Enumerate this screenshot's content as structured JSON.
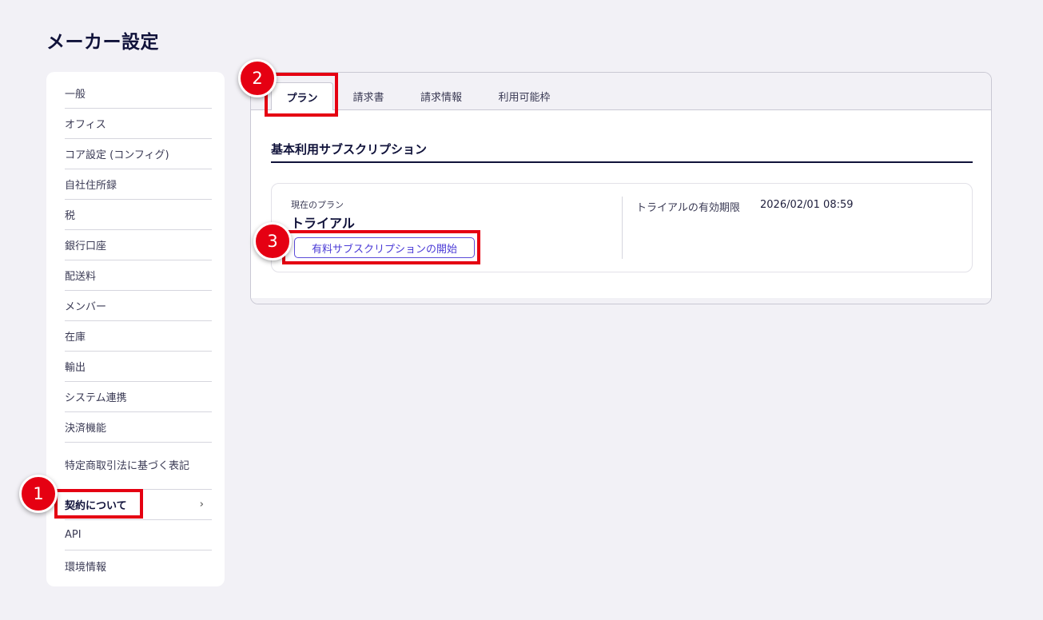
{
  "page": {
    "title": "メーカー設定"
  },
  "sidebar": {
    "items": [
      {
        "label": "一般"
      },
      {
        "label": "オフィス"
      },
      {
        "label": "コア設定 (コンフィグ)"
      },
      {
        "label": "自社住所録"
      },
      {
        "label": "税"
      },
      {
        "label": "銀行口座"
      },
      {
        "label": "配送料"
      },
      {
        "label": "メンバー"
      },
      {
        "label": "在庫"
      },
      {
        "label": "輸出"
      },
      {
        "label": "システム連携"
      },
      {
        "label": "決済機能"
      },
      {
        "label": "特定商取引法に基づく表記"
      },
      {
        "label": "契約について",
        "chevron": "›"
      },
      {
        "label": "API"
      },
      {
        "label": "環境情報"
      }
    ]
  },
  "tabs": [
    {
      "label": "プラン"
    },
    {
      "label": "請求書"
    },
    {
      "label": "請求情報"
    },
    {
      "label": "利用可能枠"
    }
  ],
  "content": {
    "section_title": "基本利用サブスクリプション",
    "current_plan_label": "現在のプラン",
    "current_plan_value": "トライアル",
    "start_button": "有料サブスクリプションの開始",
    "trial_expiry_label": "トライアルの有効期限",
    "trial_expiry_value": "2026/02/01 08:59"
  },
  "annotations": {
    "badge1": "1",
    "badge2": "2",
    "badge3": "3"
  },
  "colors": {
    "accent": "#e50012",
    "primary": "#4b3bd6",
    "navy": "#10123a",
    "background": "#f2f1f6"
  }
}
